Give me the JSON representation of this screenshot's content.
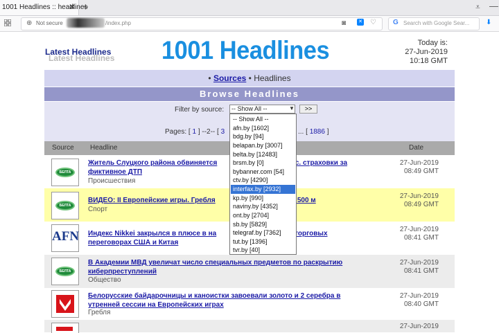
{
  "browser": {
    "tab_title": "1001 Headlines :: headlines",
    "tab_close": "✕",
    "new_tab": "+",
    "menu_glyph": "⩡",
    "min_glyph": "—",
    "not_secure": "Not secure",
    "url_suffix": "/index.php",
    "search_placeholder": "Search with Google Sear...",
    "icons": [
      "grid-icon",
      "globe-icon",
      "camera-icon",
      "extension-icon",
      "heart-icon",
      "google-icon",
      "download-icon"
    ]
  },
  "header": {
    "latest_headlines": "Latest Headlines",
    "logo": "1001 Headlines",
    "today_label": "Today is:",
    "today_date": "27-Jun-2019",
    "today_time": "10:18 GMT"
  },
  "breadcrumb": {
    "bullet": "•",
    "sources": "Sources",
    "separator": "•",
    "current": "Headlines"
  },
  "browse_title": "Browse Headlines",
  "filter": {
    "label": "Filter by source:",
    "selected": "-- Show All --",
    "go": ">>",
    "options": [
      "-- Show All --",
      "afn.by [1602]",
      "bdg.by [94]",
      "belapan.by [3007]",
      "belta.by [12483]",
      "brsm.by [0]",
      "bybanner.com [54]",
      "ctv.by [4290]",
      "interfax.by [2932]",
      "kp.by [990]",
      "naviny.by [4352]",
      "ont.by [2704]",
      "sb.by [5829]",
      "telegraf.by [7362]",
      "tut.by [1396]",
      "tvr.by [40]"
    ],
    "highlighted": "interfax.by [2932]"
  },
  "pages": {
    "prefix": "Pages: [",
    "p1": "1",
    "mid": "] --2-- [",
    "p3": "3",
    "end_dots": "...",
    "sep": " [",
    "last": "1886",
    "suffix": " ]"
  },
  "table": {
    "headers": {
      "source": "Source",
      "headline": "Headline",
      "date": "Date"
    },
    "rows": [
      {
        "logo": "БЕЛТА",
        "headline_a": "Житель Слуцкого района обвиняется",
        "headline_b": "ыс. страховки за",
        "headline_line2": "фиктивное ДТП",
        "category": "Происшествия",
        "date": "27-Jun-2019",
        "time": "08:49 GMT"
      },
      {
        "logo": "БЕЛТА",
        "headline_a": "ВИДЕО: II Европейские игры. Гребля",
        "headline_b": "ы. 500 м",
        "headline_line2": "",
        "category": "Спорт",
        "date": "27-Jun-2019",
        "time": "08:49 GMT"
      },
      {
        "logo": "AFN",
        "headline_a": "Индекс Nikkei закрылся в плюсе в на",
        "headline_b": "в торговых",
        "headline_line2": "переговорах США и Китая",
        "category": "",
        "date": "27-Jun-2019",
        "time": "08:41 GMT"
      },
      {
        "logo": "БЕЛТА",
        "headline_a": "В Академии МВД увеличат число специальных предметов по раскрытию",
        "headline_b": "",
        "headline_line2": "киберпреступлений",
        "category": "Общество",
        "date": "27-Jun-2019",
        "time": "08:41 GMT"
      },
      {
        "logo": "tvr",
        "headline_a": "Белорусские байдарочницы и каноистки завоевали золото и 2 серебра в",
        "headline_b": "",
        "headline_line2": "утренней сессии на Европейских играх",
        "category": "Гребля",
        "date": "27-Jun-2019",
        "time": "08:40 GMT"
      },
      {
        "logo": "",
        "headline_a": "",
        "headline_b": "",
        "headline_line2": "",
        "category": "",
        "date": "27-Jun-2019",
        "time": ""
      }
    ]
  },
  "colors": {
    "accent": "#1a8fe0",
    "link": "#1a1aa6",
    "highlight_row": "#ffffa8",
    "alt_row": "#ececec"
  }
}
